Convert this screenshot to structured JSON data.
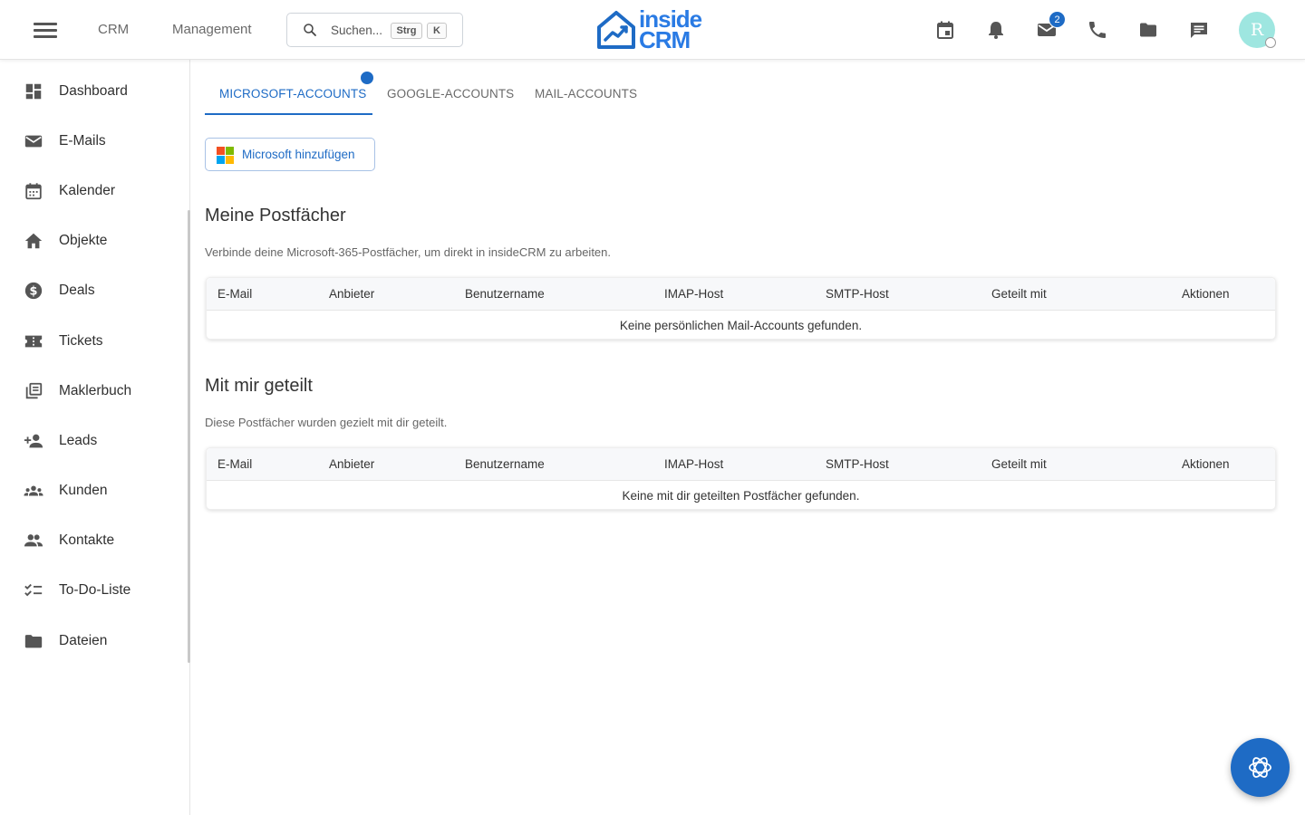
{
  "header": {
    "nav": [
      "CRM",
      "Management"
    ],
    "search": {
      "placeholder": "Suchen...",
      "shortcut_modifier": "Strg",
      "shortcut_key": "K"
    },
    "logo": {
      "line1": "inside",
      "line2": "CRM"
    },
    "icons": [
      "calendar-icon",
      "bell-icon",
      "mail-icon",
      "phone-icon",
      "folder-icon",
      "chat-icon"
    ],
    "mail_badge": "2",
    "avatar_initial": "R",
    "accent_color": "#1e6bc5"
  },
  "sidebar": {
    "items": [
      {
        "label": "Dashboard",
        "icon": "dashboard-icon"
      },
      {
        "label": "E-Mails",
        "icon": "mail-icon"
      },
      {
        "label": "Kalender",
        "icon": "calendar-icon"
      },
      {
        "label": "Objekte",
        "icon": "home-icon"
      },
      {
        "label": "Deals",
        "icon": "dollar-icon"
      },
      {
        "label": "Tickets",
        "icon": "ticket-icon"
      },
      {
        "label": "Maklerbuch",
        "icon": "library-icon"
      },
      {
        "label": "Leads",
        "icon": "person-add-icon"
      },
      {
        "label": "Kunden",
        "icon": "groups-icon"
      },
      {
        "label": "Kontakte",
        "icon": "people-icon"
      },
      {
        "label": "To-Do-Liste",
        "icon": "checklist-icon"
      },
      {
        "label": "Dateien",
        "icon": "folder-icon"
      }
    ]
  },
  "tabs": [
    {
      "label": "MICROSOFT-ACCOUNTS",
      "active": true
    },
    {
      "label": "GOOGLE-ACCOUNTS",
      "active": false
    },
    {
      "label": "MAIL-ACCOUNTS",
      "active": false
    }
  ],
  "add_button": {
    "label": "Microsoft hinzufügen",
    "icon": "microsoft-icon"
  },
  "columns": [
    "E-Mail",
    "Anbieter",
    "Benutzername",
    "IMAP-Host",
    "SMTP-Host",
    "Geteilt mit",
    "Aktionen"
  ],
  "sections": [
    {
      "title": "Meine Postfächer",
      "description": "Verbinde deine Microsoft-365-Postfächer, um direkt in insideCRM zu arbeiten.",
      "empty_text": "Keine persönlichen Mail-Accounts gefunden."
    },
    {
      "title": "Mit mir geteilt",
      "description": "Diese Postfächer wurden gezielt mit dir geteilt.",
      "empty_text": "Keine mit dir geteilten Postfächer gefunden."
    }
  ],
  "fab": {
    "icon": "ai-assistant-icon"
  }
}
